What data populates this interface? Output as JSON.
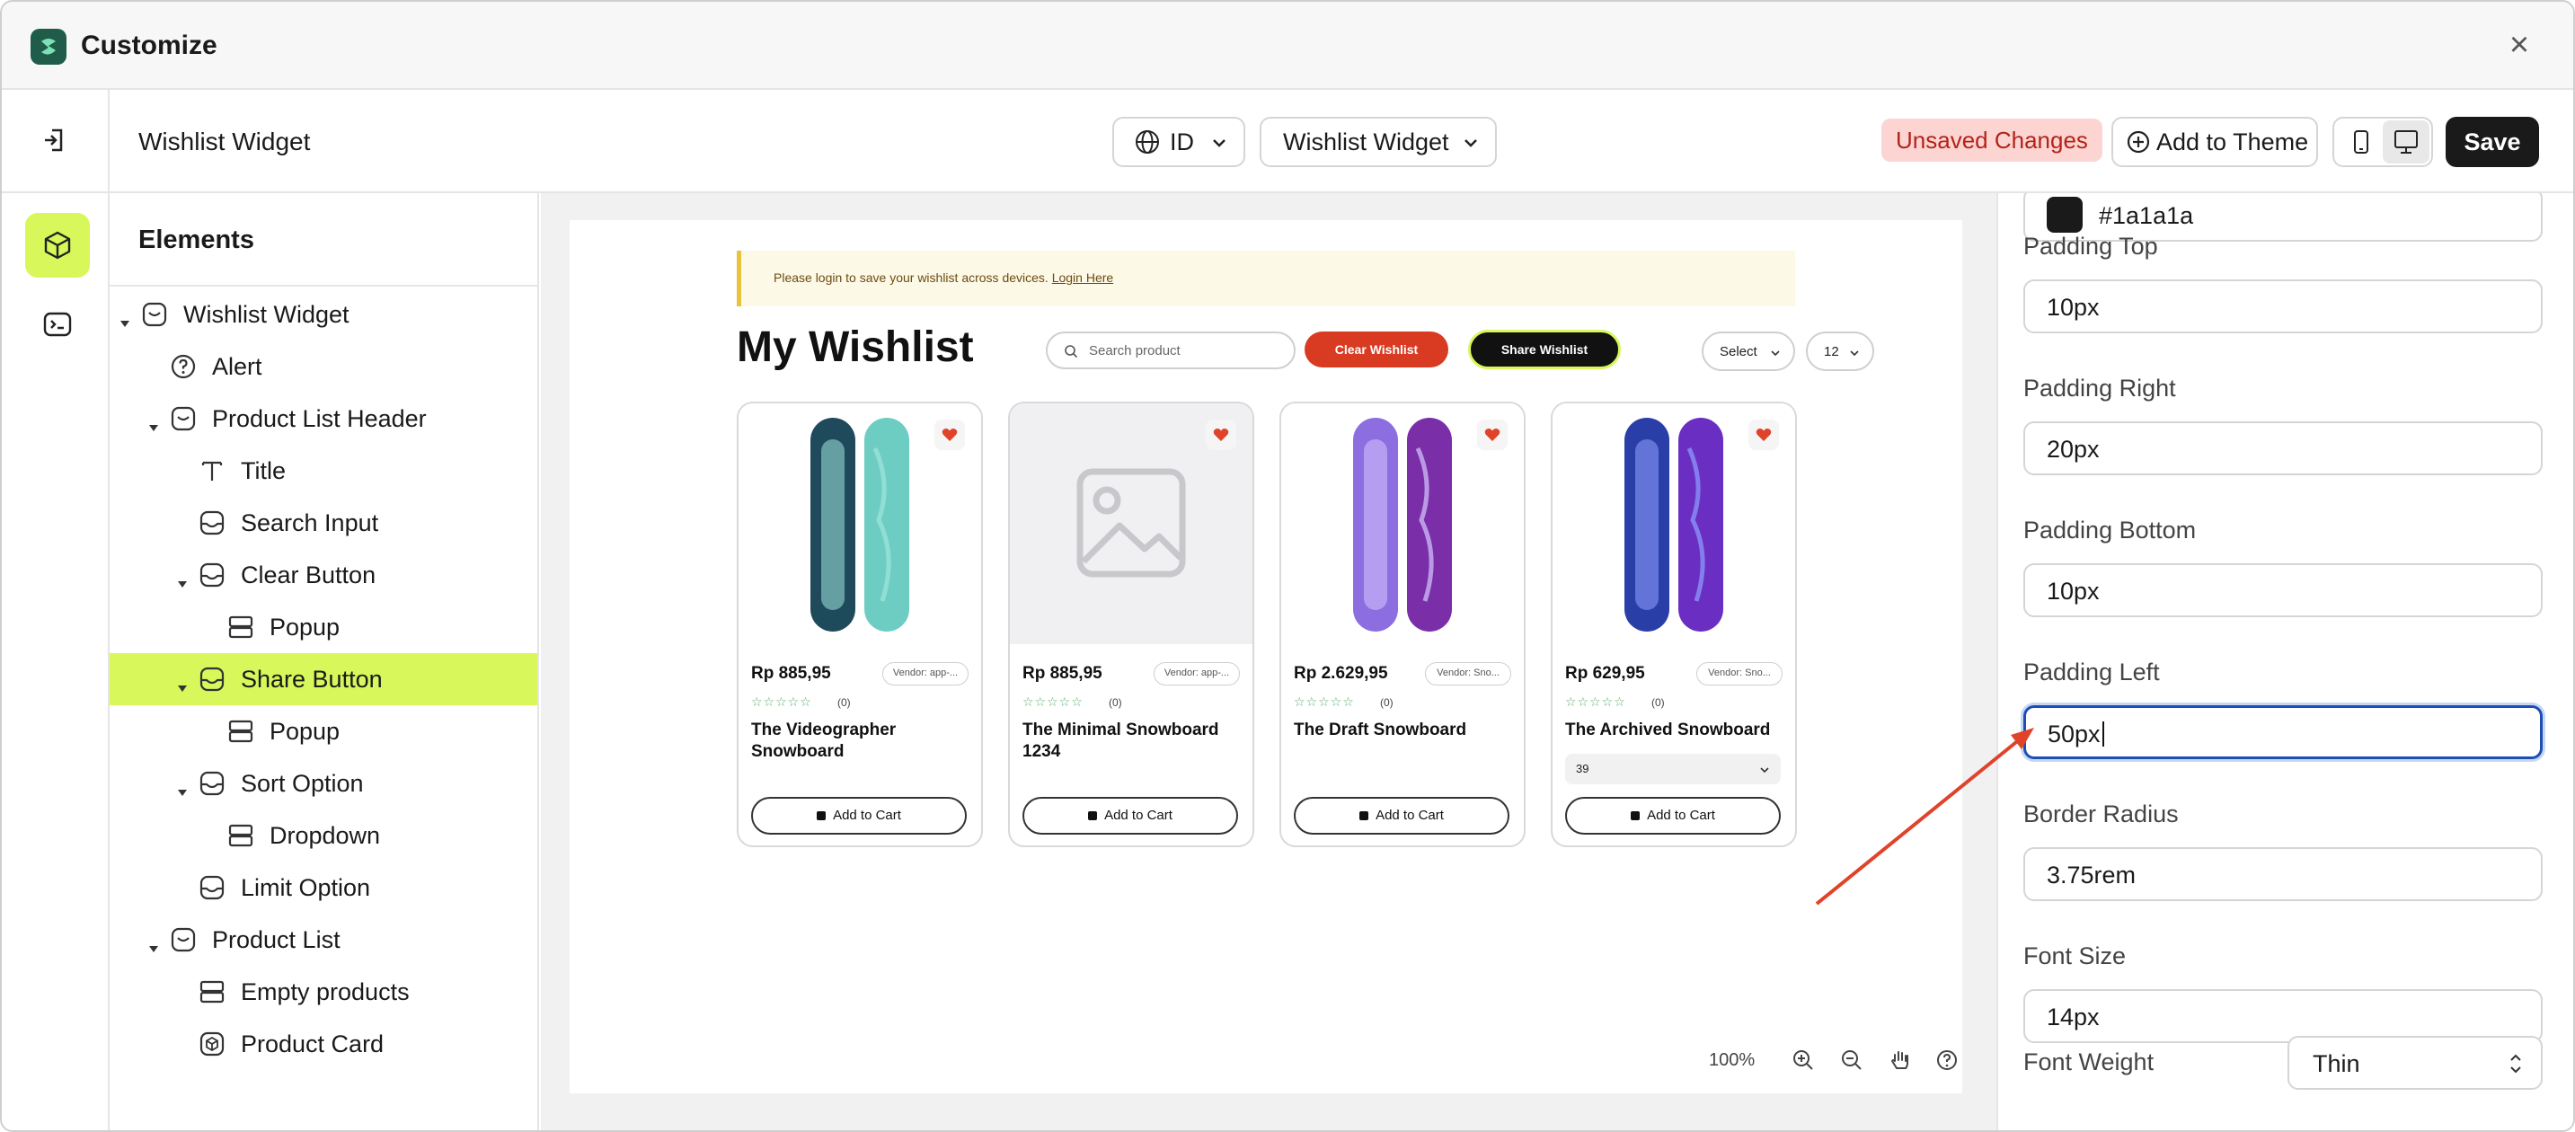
{
  "window": {
    "title": "Customize"
  },
  "toolbar": {
    "page_title": "Wishlist Widget",
    "language": "ID",
    "widget_select": "Wishlist Widget",
    "unsaved_badge": "Unsaved Changes",
    "add_to_theme": "Add to Theme",
    "save": "Save"
  },
  "elements_panel": {
    "heading": "Elements",
    "tree": [
      {
        "label": "Wishlist Widget",
        "level": 0,
        "expanded": true,
        "icon": "widget-icon"
      },
      {
        "label": "Alert",
        "level": 1,
        "expanded": null,
        "icon": "help-circle-icon"
      },
      {
        "label": "Product List Header",
        "level": 1,
        "expanded": true,
        "icon": "widget-icon"
      },
      {
        "label": "Title",
        "level": 2,
        "expanded": null,
        "icon": "text-icon"
      },
      {
        "label": "Search Input",
        "level": 2,
        "expanded": null,
        "icon": "component-icon"
      },
      {
        "label": "Clear Button",
        "level": 2,
        "expanded": true,
        "icon": "component-icon"
      },
      {
        "label": "Popup",
        "level": 3,
        "expanded": null,
        "icon": "section-icon"
      },
      {
        "label": "Share Button",
        "level": 2,
        "expanded": true,
        "icon": "component-icon",
        "selected": true
      },
      {
        "label": "Popup",
        "level": 3,
        "expanded": null,
        "icon": "section-icon"
      },
      {
        "label": "Sort Option",
        "level": 2,
        "expanded": true,
        "icon": "component-icon"
      },
      {
        "label": "Dropdown",
        "level": 3,
        "expanded": null,
        "icon": "section-icon"
      },
      {
        "label": "Limit Option",
        "level": 2,
        "expanded": null,
        "icon": "component-icon"
      },
      {
        "label": "Product List",
        "level": 1,
        "expanded": true,
        "icon": "widget-icon"
      },
      {
        "label": "Empty products",
        "level": 2,
        "expanded": null,
        "icon": "section-icon"
      },
      {
        "label": "Product Card",
        "level": 2,
        "expanded": null,
        "icon": "cube-icon"
      }
    ]
  },
  "preview": {
    "alert_text": "Please login to save your wishlist across devices.",
    "alert_link": "Login Here",
    "title": "My Wishlist",
    "search_placeholder": "Search product",
    "clear_button": "Clear Wishlist",
    "share_button": "Share Wishlist",
    "sort_value": "Select",
    "limit_value": "12",
    "products": [
      {
        "price": "Rp 885,95",
        "vendor": "Vendor: app-...",
        "reviews": "(0)",
        "name": "The Videographer Snowboard",
        "variant": "",
        "add_to_cart": "Add to Cart",
        "image": "snowboard-pair-teal"
      },
      {
        "price": "Rp 885,95",
        "vendor": "Vendor: app-...",
        "reviews": "(0)",
        "name": "The Minimal Snowboard 1234",
        "variant": "",
        "add_to_cart": "Add to Cart",
        "image": "placeholder"
      },
      {
        "price": "Rp 2.629,95",
        "vendor": "Vendor: Sno...",
        "reviews": "(0)",
        "name": "The Draft Snowboard",
        "variant": "",
        "add_to_cart": "Add to Cart",
        "image": "snowboard-pair-purple"
      },
      {
        "price": "Rp 629,95",
        "vendor": "Vendor: Sno...",
        "reviews": "(0)",
        "name": "The Archived Snowboard",
        "variant": "39",
        "add_to_cart": "Add to Cart",
        "image": "snowboard-pair-blue"
      }
    ],
    "zoom": "100%"
  },
  "properties": {
    "color_value": "#1a1a1a",
    "fields": [
      {
        "label": "Padding Top",
        "value": "10px"
      },
      {
        "label": "Padding Right",
        "value": "20px"
      },
      {
        "label": "Padding Bottom",
        "value": "10px"
      },
      {
        "label": "Padding Left",
        "value": "50px"
      },
      {
        "label": "Border Radius",
        "value": "3.75rem"
      },
      {
        "label": "Font Size",
        "value": "14px"
      }
    ],
    "font_weight_label": "Font Weight",
    "font_weight_value": "Thin"
  },
  "colors": {
    "accent": "#d7f75b",
    "clear_button": "#d93a22",
    "focus_ring": "#1d4fb3",
    "annotation_arrow": "#e0432a"
  }
}
